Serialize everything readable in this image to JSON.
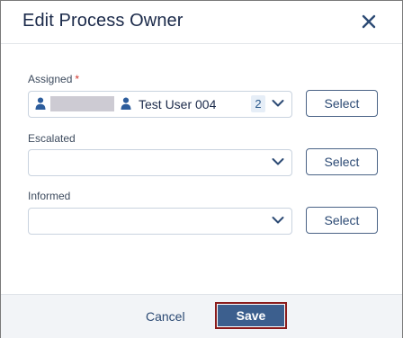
{
  "dialog": {
    "title": "Edit Process Owner"
  },
  "fields": {
    "assigned": {
      "label": "Assigned",
      "required_marker": "*",
      "selected_user": "Test User 004",
      "count": "2",
      "select_label": "Select"
    },
    "escalated": {
      "label": "Escalated",
      "select_label": "Select"
    },
    "informed": {
      "label": "Informed",
      "select_label": "Select"
    }
  },
  "footer": {
    "cancel_label": "Cancel",
    "save_label": "Save"
  },
  "colors": {
    "primary": "#3c5f8e",
    "title_text": "#1b2a4a",
    "required": "#d0342c",
    "focus_outline": "#8a1c1c"
  },
  "icons": {
    "close": "close-icon",
    "user": "person-icon",
    "dropdown": "chevron-down-icon"
  }
}
